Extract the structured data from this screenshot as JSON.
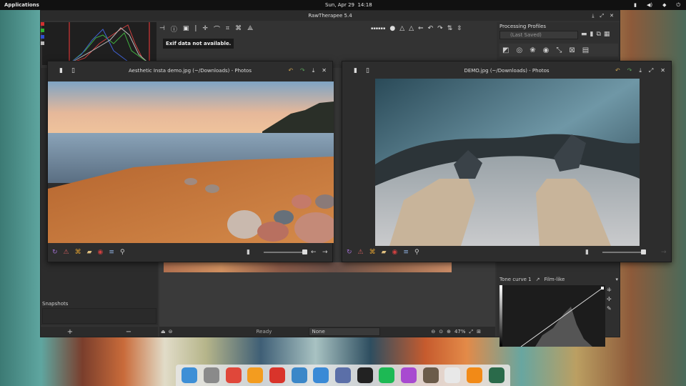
{
  "topbar": {
    "applications": "Applications",
    "clock": "Sun, Apr 29",
    "time": "14:18"
  },
  "rawtherapee": {
    "title": "RawTherapee 5.4",
    "exif_text": "Exif data not available.",
    "snapshots_label": "Snapshots",
    "status_ready": "Ready",
    "none_select": "None",
    "zoom": "47%",
    "processing_profiles_label": "Processing Profiles",
    "profile_value": "(Last Saved)",
    "tone_curve_label": "Tone curve 1",
    "curve_mode": "Film-like",
    "add_label": "+",
    "remove_label": "−"
  },
  "photos1": {
    "title": "Aesthetic Insta demo.jpg (~/Downloads) - Photos"
  },
  "photos2": {
    "title": "DEMO.jpg (~/Downloads) - Photos"
  },
  "dock": {
    "icons": [
      {
        "name": "multitasking-view-icon",
        "color": "#3d8fd6"
      },
      {
        "name": "files-icon",
        "color": "#8a8a8a"
      },
      {
        "name": "chrome-icon",
        "color": "#e0473a"
      },
      {
        "name": "music-icon",
        "color": "#f39c1f"
      },
      {
        "name": "videos-icon",
        "color": "#d9342b"
      },
      {
        "name": "photos-icon",
        "color": "#3b87c8"
      },
      {
        "name": "settings-toggle-icon",
        "color": "#3a8ad6"
      },
      {
        "name": "appcenter-icon",
        "color": "#5b6fa8"
      },
      {
        "name": "terminal-icon",
        "color": "#222222"
      },
      {
        "name": "spotify-icon",
        "color": "#1db954"
      },
      {
        "name": "color-picker-icon",
        "color": "#a84ad0"
      },
      {
        "name": "gimp-icon",
        "color": "#6b5b4a"
      },
      {
        "name": "text-editor-icon",
        "color": "#e8e8e8"
      },
      {
        "name": "vlc-icon",
        "color": "#f28a17"
      },
      {
        "name": "rawtherapee-icon",
        "color": "#2a6a4a"
      }
    ]
  }
}
